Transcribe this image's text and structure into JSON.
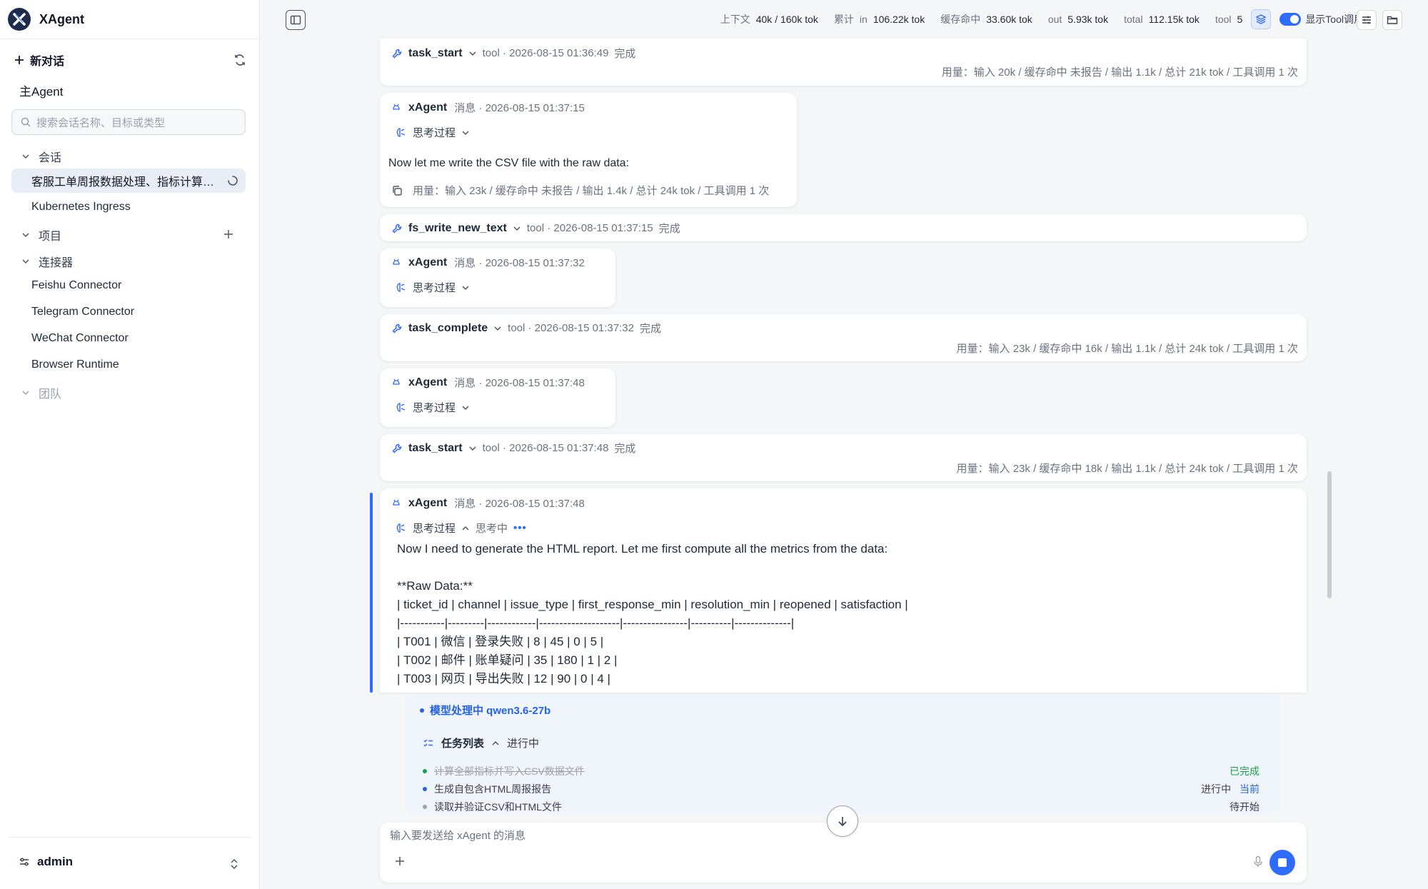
{
  "app": {
    "name": "XAgent"
  },
  "sidebar": {
    "new_chat": "新对话",
    "main_agent": "主Agent",
    "search_placeholder": "搜索会话名称、目标或类型",
    "sections": {
      "sessions": "会话",
      "projects": "项目",
      "connectors": "连接器",
      "team": "团队"
    },
    "session_items": [
      "客服工单周报数据处理、指标计算和HTML报告生成",
      "Kubernetes Ingress"
    ],
    "connector_items": [
      "Feishu Connector",
      "Telegram Connector",
      "WeChat Connector",
      "Browser Runtime"
    ],
    "user": "admin"
  },
  "topbar": {
    "context_label": "上下文",
    "context_value": "40k / 160k tok",
    "cumulative_label": "累计",
    "in_label": "in",
    "in_value": "106.22k tok",
    "cache_label": "缓存命中",
    "cache_value": "33.60k tok",
    "out_label": "out",
    "out_value": "5.93k tok",
    "total_label": "total",
    "total_value": "112.15k tok",
    "tool_label": "tool",
    "tool_value": "5",
    "show_tool_label": "显示Tool调用"
  },
  "messages": [
    {
      "kind": "tool",
      "name": "task_start",
      "meta": "tool · 2026-08-15 01:36:49",
      "status": "完成",
      "usage": "用量：输入 20k / 缓存命中 未报告 / 输出 1.1k / 总计 21k tok / 工具调用 1 次"
    },
    {
      "kind": "agent",
      "who": "xAgent",
      "meta": "消息 · 2026-08-15 01:37:15",
      "think": "思考过程",
      "text": "Now let me write the CSV file with the raw data:",
      "usage": "用量：输入 23k / 缓存命中 未报告 / 输出 1.4k / 总计 24k tok / 工具调用 1 次"
    },
    {
      "kind": "tool",
      "name": "fs_write_new_text",
      "meta": "tool · 2026-08-15 01:37:15",
      "status": "完成"
    },
    {
      "kind": "agent",
      "who": "xAgent",
      "meta": "消息 · 2026-08-15 01:37:32",
      "think": "思考过程"
    },
    {
      "kind": "tool",
      "name": "task_complete",
      "meta": "tool · 2026-08-15 01:37:32",
      "status": "完成",
      "usage": "用量：输入 23k / 缓存命中 16k / 输出 1.1k / 总计 24k tok / 工具调用 1 次"
    },
    {
      "kind": "agent",
      "who": "xAgent",
      "meta": "消息 · 2026-08-15 01:37:48",
      "think": "思考过程"
    },
    {
      "kind": "tool",
      "name": "task_start",
      "meta": "tool · 2026-08-15 01:37:48",
      "status": "完成",
      "usage": "用量：输入 23k / 缓存命中 18k / 输出 1.1k / 总计 24k tok / 工具调用 1 次"
    },
    {
      "kind": "agent",
      "who": "xAgent",
      "meta": "消息 · 2026-08-15 01:37:48",
      "think": "思考过程",
      "thinking_status": "思考中",
      "body": "Now I need to generate the HTML report. Let me first compute all the metrics from the data:\n\n**Raw Data:**\n| ticket_id | channel | issue_type | first_response_min | resolution_min | reopened | satisfaction |\n|-----------|---------|------------|--------------------|----------------|----------|--------------|\n| T001 | 微信 | 登录失败 | 8 | 45 | 0 | 5 |\n| T002 | 邮件 | 账单疑问 | 35 | 180 | 1 | 2 |\n| T003 | 网页 | 导出失败 | 12 | 90 | 0 | 4 |"
    }
  ],
  "status_panel": {
    "model_label": "模型处理中 qwen3.6-27b",
    "task_list_label": "任务列表",
    "task_list_status": "进行中",
    "tasks": [
      {
        "text": "计算全部指标并写入CSV数据文件",
        "status": "已完成",
        "color": "#16a34a"
      },
      {
        "text": "生成自包含HTML周报报告",
        "status": "进行中",
        "current": "当前",
        "color": "#2563eb"
      },
      {
        "text": "读取并验证CSV和HTML文件",
        "status": "待开始",
        "color": "#9ca3af"
      }
    ]
  },
  "composer": {
    "placeholder": "输入要发送给 xAgent 的消息"
  },
  "colors": {
    "accent": "#2f6bff",
    "done": "#16a34a",
    "sidebar_active": "#e8edf6"
  }
}
